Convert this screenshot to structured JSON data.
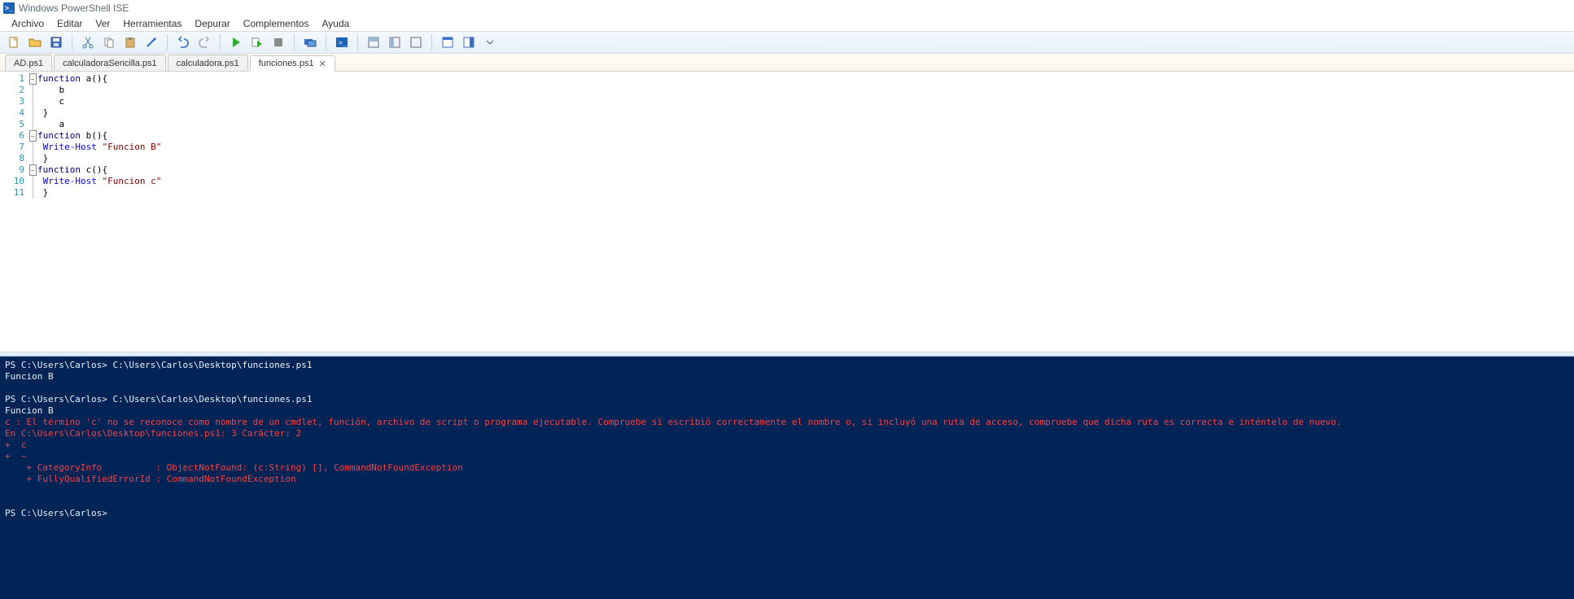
{
  "window": {
    "title": "Windows PowerShell ISE"
  },
  "menu": {
    "items": [
      "Archivo",
      "Editar",
      "Ver",
      "Herramientas",
      "Depurar",
      "Complementos",
      "Ayuda"
    ]
  },
  "toolbar_icons": [
    "new-file-icon",
    "open-folder-icon",
    "save-icon",
    "cut-icon",
    "copy-icon",
    "paste-icon",
    "run-script-icon",
    "sep",
    "undo-icon",
    "redo-icon",
    "sep",
    "run-icon",
    "run-selection-icon",
    "stop-icon",
    "sep",
    "remote-icon",
    "sep",
    "powershell-icon",
    "sep",
    "layout-script-top-icon",
    "layout-side-icon",
    "layout-console-icon",
    "sep",
    "show-script-icon",
    "show-command-icon"
  ],
  "tabs": [
    {
      "label": "AD.ps1",
      "active": false
    },
    {
      "label": "calculadoraSencilla.ps1",
      "active": false
    },
    {
      "label": "calculadora.ps1",
      "active": false
    },
    {
      "label": "funciones.ps1",
      "active": true,
      "closeable": true
    }
  ],
  "editor": {
    "lines": [
      {
        "n": 1,
        "fold": "start",
        "tokens": [
          [
            "kw",
            "function"
          ],
          [
            "plain",
            " a(){"
          ]
        ]
      },
      {
        "n": 2,
        "fold": "mid",
        "tokens": [
          [
            "plain",
            "    b"
          ]
        ]
      },
      {
        "n": 3,
        "fold": "mid",
        "tokens": [
          [
            "plain",
            "    c"
          ]
        ]
      },
      {
        "n": 4,
        "fold": "mid",
        "tokens": [
          [
            "plain",
            " }"
          ]
        ]
      },
      {
        "n": 5,
        "fold": "mid",
        "tokens": [
          [
            "plain",
            "    a"
          ]
        ]
      },
      {
        "n": 6,
        "fold": "start",
        "tokens": [
          [
            "kw",
            "function"
          ],
          [
            "plain",
            " b(){"
          ]
        ]
      },
      {
        "n": 7,
        "fold": "mid",
        "tokens": [
          [
            "plain",
            " "
          ],
          [
            "cmd",
            "Write-Host"
          ],
          [
            "plain",
            " "
          ],
          [
            "str",
            "\"Funcion B\""
          ]
        ]
      },
      {
        "n": 8,
        "fold": "mid",
        "tokens": [
          [
            "plain",
            " }"
          ]
        ]
      },
      {
        "n": 9,
        "fold": "start",
        "tokens": [
          [
            "kw",
            "function"
          ],
          [
            "plain",
            " c(){"
          ]
        ]
      },
      {
        "n": 10,
        "fold": "mid",
        "tokens": [
          [
            "plain",
            " "
          ],
          [
            "cmd",
            "Write-Host"
          ],
          [
            "plain",
            " "
          ],
          [
            "str",
            "\"Funcion c\""
          ]
        ]
      },
      {
        "n": 11,
        "fold": "end",
        "tokens": [
          [
            "plain",
            " }"
          ]
        ]
      }
    ]
  },
  "console": {
    "lines": [
      {
        "cls": "out",
        "text": "PS C:\\Users\\Carlos> C:\\Users\\Carlos\\Desktop\\funciones.ps1"
      },
      {
        "cls": "out",
        "text": "Funcion B"
      },
      {
        "cls": "out",
        "text": ""
      },
      {
        "cls": "out",
        "text": "PS C:\\Users\\Carlos> C:\\Users\\Carlos\\Desktop\\funciones.ps1"
      },
      {
        "cls": "out",
        "text": "Funcion B"
      },
      {
        "cls": "err",
        "text": "c : El término 'c' no se reconoce como nombre de un cmdlet, función, archivo de script o programa ejecutable. Compruebe si escribió correctamente el nombre o, si incluyó una ruta de acceso, compruebe que dicha ruta es correcta e inténtelo de nuevo."
      },
      {
        "cls": "err",
        "text": "En C:\\Users\\Carlos\\Desktop\\funciones.ps1: 3 Carácter: 2"
      },
      {
        "cls": "err",
        "text": "+  c"
      },
      {
        "cls": "err",
        "text": "+  ~"
      },
      {
        "cls": "err",
        "text": "    + CategoryInfo          : ObjectNotFound: (c:String) [], CommandNotFoundException"
      },
      {
        "cls": "err",
        "text": "    + FullyQualifiedErrorId : CommandNotFoundException"
      },
      {
        "cls": "out",
        "text": " "
      },
      {
        "cls": "out",
        "text": ""
      },
      {
        "cls": "out",
        "text": "PS C:\\Users\\Carlos> "
      }
    ]
  }
}
